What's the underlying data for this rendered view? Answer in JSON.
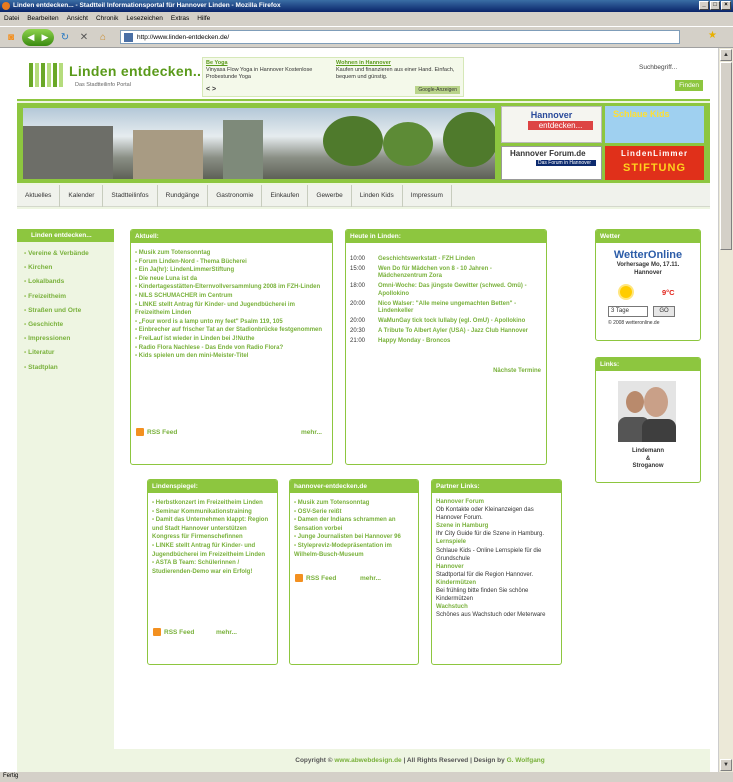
{
  "window": {
    "title": "Linden entdecken... - Stadtteil Informationsportal für Hannover Linden - Mozilla Firefox"
  },
  "menu": [
    "Datei",
    "Bearbeiten",
    "Ansicht",
    "Chronik",
    "Lesezeichen",
    "Extras",
    "Hilfe"
  ],
  "url": "http://www.linden-entdecken.de/",
  "status": "Fertig",
  "site": {
    "title": "Linden entdecken...",
    "subtitle": "Das Stadtteilinfo Portal"
  },
  "ads": [
    {
      "title": "Be Yoga",
      "text": "Vinyasa Flow Yoga in Hannover Kostenlose Probestunde Yoga"
    },
    {
      "title": "Wohnen in Hannover",
      "text": "Kaufen und finanzieren aus einer Hand. Einfach, bequem und günstig."
    }
  ],
  "ads_nav": "< >",
  "ads_badge": "Google-Anzeigen",
  "search": {
    "label": "Suchbegriff...",
    "button": "Finden"
  },
  "banners": {
    "b1_title": "Hannover",
    "b1_sub": "entdecken...",
    "b2": "Schlaue Kids",
    "b3_title": "Hannover Forum.de",
    "b3_tag": "Hannover Tipp!",
    "b3_sub": "Das Forum in Hannover",
    "b4_a": "LindenLimmer",
    "b4_b": "STIFTUNG"
  },
  "nav": [
    "Aktuelles",
    "Kalender",
    "Stadtteilinfos",
    "Rundgänge",
    "Gastronomie",
    "Einkaufen",
    "Gewerbe",
    "Linden Kids",
    "Impressum"
  ],
  "sidebar": {
    "heading": "Linden entdecken...",
    "items": [
      "Vereine & Verbände",
      "Kirchen",
      "Lokalbands",
      "Freizeitheim",
      "Straßen und Orte",
      "Geschichte",
      "Impressionen",
      "Literatur",
      "Stadtplan"
    ]
  },
  "aktuell": {
    "heading": "Aktuell:",
    "items": [
      "Musik zum Totensonntag",
      "Forum Linden-Nord - Thema Bücherei",
      "Ein Ja(hr): LindenLimmerStiftung",
      "Die neue Luna ist da",
      "Kindertagesstätten-Elternvollversammlung 2008 im FZH-Linden",
      "NILS SCHUMACHER im Centrum",
      "LINKE stellt Antrag für Kinder- und Jugendbücherei im Freizeitheim Linden",
      "„Four word is a lamp unto my feet\" Psalm 119, 105",
      "Einbrecher auf frischer Tat an der Stadionbrücke festgenommen",
      "FreiLauf ist wieder in Linden bei J!Nuthe",
      "Radio Flora Nachlese - Das Ende von Radio Flora?",
      "Kids spielen um den mini-Meister-Titel"
    ],
    "rss": "RSS Feed",
    "more": "mehr..."
  },
  "heute": {
    "heading": "Heute in Linden:",
    "events": [
      {
        "time": "10:00",
        "title": "Geschichtswerkstatt - FZH Linden"
      },
      {
        "time": "15:00",
        "title": "Wen Do für Mädchen von 8 - 10 Jahren - Mädchenzentrum Zora"
      },
      {
        "time": "18:00",
        "title": "Omni-Woche: Das jüngste Gewitter (schwed. Omü) - Apollokino"
      },
      {
        "time": "20:00",
        "title": "Nico Walser: \"Alle meine ungemachten Betten\" - Lindenkeller"
      },
      {
        "time": "20:00",
        "title": "WaMunGay tick tock lullaby (egl. OmU) - Apollokino"
      },
      {
        "time": "20:30",
        "title": "A Tribute To Albert Ayler (USA) - Jazz Club Hannover"
      },
      {
        "time": "21:00",
        "title": "Happy Monday - Broncos"
      }
    ],
    "next": "Nächste Termine"
  },
  "wetter": {
    "heading": "Wetter",
    "logo": "WetterOnline",
    "line1": "Vorhersage Mo, 17.11.",
    "line2": "Hannover",
    "temp": "9°C",
    "select": "3 Tage",
    "go": "GO",
    "copyright": "© 2008 wetteronline.de"
  },
  "links": {
    "heading": "Links:",
    "caption1": "Lindemann",
    "caption2": "&",
    "caption3": "Stroganow"
  },
  "lindenspiegel": {
    "heading": "Lindenspiegel:",
    "items": [
      "Herbstkonzert im Freizeitheim Linden",
      "Seminar Kommunikationstraining",
      "Damit das Unternehmen klappt: Region und Stadt Hannover unterstützen Kongress für Firmenschefinnen",
      "LINKE stellt Antrag für Kinder- und Jugendbücherei im Freizeitheim Linden",
      "ASTA B Team: Schülerinnen / Studierenden-Demo war ein Erfolg!"
    ],
    "rss": "RSS Feed",
    "more": "mehr..."
  },
  "hannover": {
    "heading": "hannover-entdecken.de",
    "items": [
      "Musik zum Totensonntag",
      "OSV-Serie reißt",
      "Damen der Indians schrammen an Sensation vorbei",
      "Junge Journalisten bei Hannover 96",
      "Stylepreviz-Modepräsentation im Wilhelm-Busch-Museum"
    ],
    "rss": "RSS Feed",
    "more": "mehr..."
  },
  "partner": {
    "heading": "Partner Links:",
    "items": [
      {
        "name": "Hannover Forum",
        "text": "Ob Kontakte oder Kleinanzeigen das Hannover Forum."
      },
      {
        "name": "Szene in Hamburg",
        "text": "Ihr City Guide für die Szene in Hamburg."
      },
      {
        "name": "Lernspiele",
        "text": "Schlaue Kids - Online Lernspiele für die Grundschule"
      },
      {
        "name": "Hannover",
        "text": "Stadtportal für die Region Hannover."
      },
      {
        "name": "Kindermützen",
        "text": "Bei frühling bitte finden Sie schöne Kindermützen"
      },
      {
        "name": "Wachstuch",
        "text": "Schönes aus Wachstuch oder Meterware"
      }
    ]
  },
  "footer": {
    "pre": "Copyright ©",
    "c1": "www.abwebdesign.de",
    "mid": "| All Rights Reserved | Design by",
    "c2": "G. Wolfgang"
  }
}
